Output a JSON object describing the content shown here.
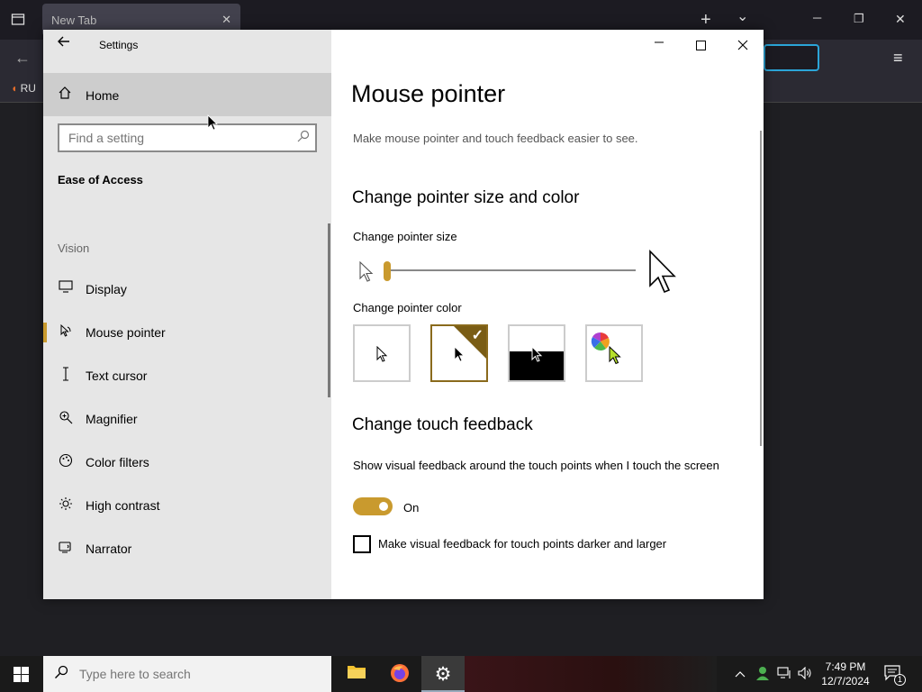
{
  "browser": {
    "tab_title": "New Tab",
    "tab_close": "✕",
    "new_tab": "+",
    "tab_list": "⌄",
    "minimize": "─",
    "restore": "❐",
    "close": "✕",
    "bookmark_label": "RU",
    "menu": "≡",
    "back": "←"
  },
  "settings": {
    "window_title": "Settings",
    "back_icon": "back-arrow-icon",
    "home_label": "Home",
    "search_placeholder": "Find a setting",
    "section_title": "Ease of Access",
    "group_label": "Vision",
    "nav_items": [
      {
        "label": "Display",
        "icon": "display-icon",
        "active": false
      },
      {
        "label": "Mouse pointer",
        "icon": "mouse-pointer-icon",
        "active": true
      },
      {
        "label": "Text cursor",
        "icon": "text-cursor-icon",
        "active": false
      },
      {
        "label": "Magnifier",
        "icon": "magnifier-icon",
        "active": false
      },
      {
        "label": "Color filters",
        "icon": "color-filters-icon",
        "active": false
      },
      {
        "label": "High contrast",
        "icon": "high-contrast-icon",
        "active": false
      },
      {
        "label": "Narrator",
        "icon": "narrator-icon",
        "active": false
      }
    ],
    "page_title": "Mouse pointer",
    "description": "Make mouse pointer and touch feedback easier to see.",
    "size_color_heading": "Change pointer size and color",
    "size_label": "Change pointer size",
    "size_value": 1,
    "color_label": "Change pointer color",
    "color_options": [
      {
        "name": "white",
        "selected": false
      },
      {
        "name": "black",
        "selected": true
      },
      {
        "name": "inverted",
        "selected": false
      },
      {
        "name": "custom",
        "selected": false
      }
    ],
    "touch_heading": "Change touch feedback",
    "touch_label": "Show visual feedback around the touch points when I touch the screen",
    "toggle_state": "On",
    "checkbox_label": "Make visual feedback for touch points darker and larger",
    "checkbox_checked": false
  },
  "taskbar": {
    "search_placeholder": "Type here to search",
    "time": "7:49 PM",
    "date": "12/7/2024",
    "notification_count": "1"
  },
  "colors": {
    "accent": "#c99a2e",
    "accent_dark": "#7a5d15"
  }
}
